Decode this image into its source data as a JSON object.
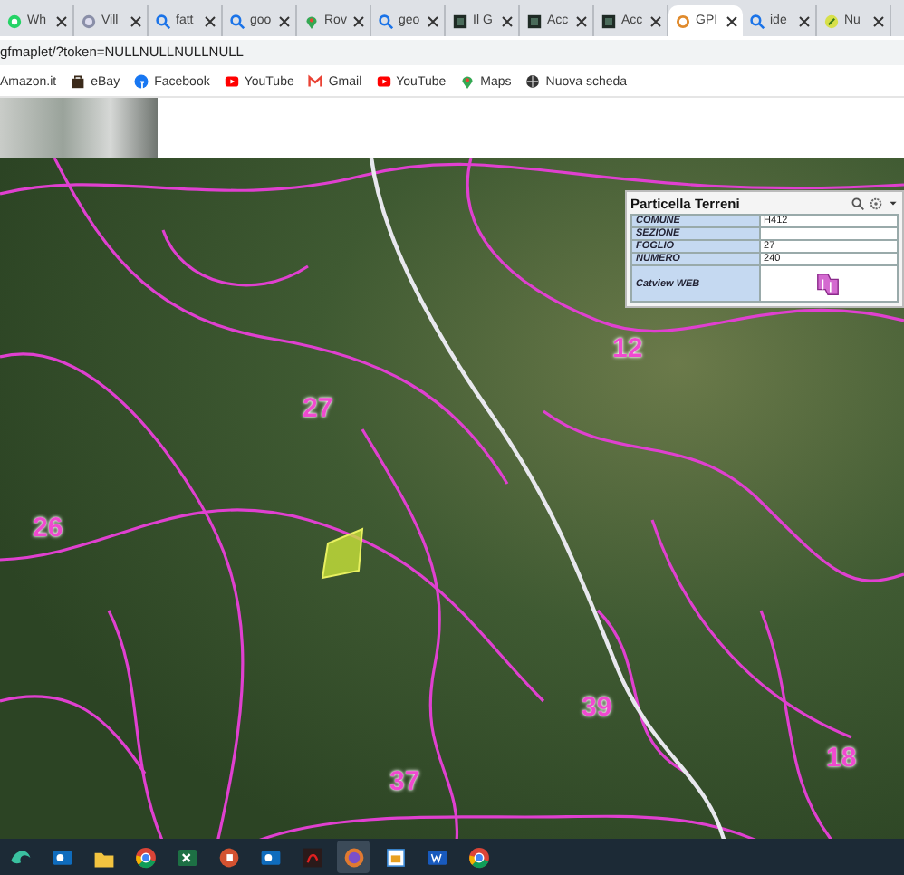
{
  "tabs": [
    {
      "label": "Wh",
      "kind": "chat",
      "selected": false
    },
    {
      "label": "Vill",
      "kind": "face",
      "selected": false
    },
    {
      "label": "fatt",
      "kind": "search",
      "selected": false
    },
    {
      "label": "goo",
      "kind": "search",
      "selected": false
    },
    {
      "label": "Rov",
      "kind": "pin",
      "selected": false
    },
    {
      "label": "geo",
      "kind": "search",
      "selected": false
    },
    {
      "label": "Il G",
      "kind": "dark",
      "selected": false
    },
    {
      "label": "Acc",
      "kind": "dark",
      "selected": false
    },
    {
      "label": "Acc",
      "kind": "dark",
      "selected": false
    },
    {
      "label": "GPI",
      "kind": "loader",
      "selected": true
    },
    {
      "label": "ide",
      "kind": "search",
      "selected": false
    },
    {
      "label": "Nu",
      "kind": "leaf",
      "selected": false
    }
  ],
  "address_bar": {
    "url": "gfmaplet/?token=NULLNULLNULLNULL"
  },
  "bookmarks": [
    {
      "label": "Amazon.it",
      "kind": "none"
    },
    {
      "label": "eBay",
      "kind": "bag"
    },
    {
      "label": "Facebook",
      "kind": "fb"
    },
    {
      "label": "YouTube",
      "kind": "play"
    },
    {
      "label": "Gmail",
      "kind": "mail"
    },
    {
      "label": "YouTube",
      "kind": "play"
    },
    {
      "label": "Maps",
      "kind": "pin"
    },
    {
      "label": "Nuova scheda",
      "kind": "globe"
    }
  ],
  "map": {
    "labels": [
      "27",
      "12",
      "26",
      "39",
      "37",
      "18"
    ]
  },
  "info_panel": {
    "title": "Particella Terreni",
    "rows": [
      {
        "label": "COMUNE",
        "value": "H412"
      },
      {
        "label": "SEZIONE",
        "value": ""
      },
      {
        "label": "FOGLIO",
        "value": "27"
      },
      {
        "label": "NUMERO",
        "value": "240"
      },
      {
        "label": "Catview WEB",
        "kind": "link"
      }
    ]
  },
  "taskbar": [
    {
      "kind": "wave",
      "selected": false
    },
    {
      "kind": "mail",
      "selected": false
    },
    {
      "kind": "folder",
      "selected": false
    },
    {
      "kind": "browser",
      "selected": false
    },
    {
      "kind": "sheet",
      "selected": false
    },
    {
      "kind": "slides",
      "selected": false
    },
    {
      "kind": "mail",
      "selected": false
    },
    {
      "kind": "pdf",
      "selected": false
    },
    {
      "kind": "app",
      "selected": true
    },
    {
      "kind": "calendar",
      "selected": false
    },
    {
      "kind": "word",
      "selected": false
    },
    {
      "kind": "browser",
      "selected": false
    }
  ]
}
